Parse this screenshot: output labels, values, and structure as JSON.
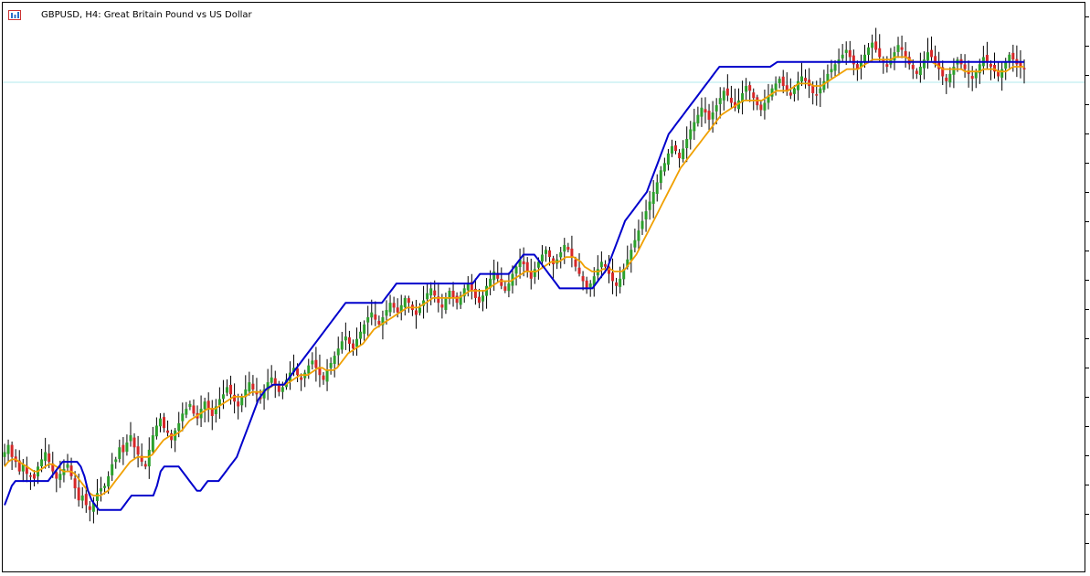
{
  "window": {
    "title": "GBPUSD, H4:  Great Britain Pound vs US Dollar",
    "symbol_text": "GBPUSD, H4:  Great Britain Pound vs US Dollar"
  },
  "icons": {
    "left": "chart-list-icon",
    "right": "chart-bars-icon"
  },
  "colors": {
    "background": "#ffffff",
    "bull": "#2ca02c",
    "bear": "#d62728",
    "wick": "#000000",
    "ma_fast": "#f0a000",
    "ma_slow": "#0000cc",
    "current_price_line": "#b0e8ee"
  },
  "chart_data": {
    "type": "line",
    "instrument": "GBPUSD",
    "timeframe": "H4",
    "grid": false,
    "candles_close": [
      88,
      91,
      86,
      84,
      80,
      83,
      79,
      78,
      77,
      82,
      85,
      88,
      84,
      80,
      77,
      79,
      81,
      83,
      78,
      73,
      68,
      70,
      66,
      64,
      67,
      71,
      73,
      74,
      78,
      83,
      85,
      90,
      88,
      92,
      95,
      90,
      87,
      84,
      82,
      89,
      95,
      99,
      102,
      98,
      96,
      93,
      97,
      100,
      104,
      106,
      108,
      104,
      102,
      106,
      109,
      106,
      103,
      107,
      110,
      112,
      115,
      112,
      109,
      107,
      111,
      114,
      117,
      114,
      112,
      110,
      114,
      117,
      119,
      116,
      113,
      115,
      118,
      121,
      123,
      120,
      118,
      121,
      124,
      126,
      123,
      120,
      118,
      122,
      125,
      128,
      131,
      134,
      136,
      133,
      131,
      135,
      138,
      141,
      144,
      146,
      143,
      141,
      144,
      147,
      150,
      148,
      146,
      149,
      152,
      150,
      147,
      145,
      148,
      151,
      154,
      156,
      153,
      150,
      148,
      152,
      155,
      152,
      150,
      153,
      156,
      158,
      155,
      152,
      150,
      153,
      157,
      160,
      163,
      160,
      157,
      155,
      158,
      162,
      165,
      168,
      166,
      163,
      160,
      164,
      167,
      170,
      172,
      169,
      166,
      168,
      171,
      174,
      172,
      169,
      165,
      162,
      159,
      156,
      158,
      161,
      164,
      167,
      165,
      162,
      159,
      157,
      160,
      164,
      168,
      172,
      176,
      180,
      184,
      188,
      192,
      196,
      200,
      205,
      208,
      212,
      215,
      213,
      210,
      214,
      218,
      222,
      225,
      228,
      231,
      229,
      226,
      229,
      232,
      235,
      238,
      236,
      233,
      231,
      234,
      237,
      240,
      238,
      235,
      232,
      230,
      233,
      236,
      239,
      241,
      243,
      240,
      238,
      236,
      239,
      242,
      244,
      242,
      240,
      237,
      236,
      239,
      242,
      245,
      247,
      249,
      251,
      253,
      255,
      252,
      249,
      247,
      250,
      253,
      256,
      258,
      255,
      252,
      250,
      248,
      251,
      254,
      257,
      255,
      252,
      249,
      247,
      245,
      248,
      251,
      254,
      252,
      249,
      247,
      244,
      242,
      245,
      248,
      251,
      249,
      247,
      245,
      243,
      246,
      249,
      252,
      250,
      248,
      246,
      244,
      247,
      250,
      253,
      251,
      249,
      248,
      247
    ],
    "ma_fast": [
      82,
      84,
      85,
      85,
      84,
      83,
      82,
      81,
      80,
      80,
      81,
      82,
      83,
      83,
      82,
      81,
      80,
      80,
      80,
      79,
      77,
      75,
      73,
      71,
      70,
      70,
      70,
      71,
      72,
      74,
      76,
      78,
      80,
      82,
      84,
      85,
      86,
      86,
      86,
      86,
      87,
      89,
      91,
      93,
      94,
      95,
      95,
      96,
      97,
      99,
      101,
      102,
      103,
      104,
      105,
      106,
      106,
      106,
      107,
      108,
      109,
      110,
      111,
      111,
      111,
      111,
      112,
      113,
      113,
      113,
      113,
      114,
      115,
      116,
      116,
      116,
      116,
      117,
      118,
      119,
      120,
      120,
      120,
      121,
      122,
      123,
      123,
      122,
      122,
      122,
      123,
      125,
      127,
      129,
      130,
      131,
      132,
      133,
      135,
      137,
      139,
      140,
      141,
      142,
      143,
      144,
      145,
      146,
      147,
      148,
      148,
      148,
      148,
      149,
      150,
      151,
      152,
      152,
      152,
      152,
      152,
      152,
      152,
      152,
      153,
      154,
      155,
      155,
      155,
      155,
      155,
      156,
      157,
      158,
      159,
      159,
      159,
      159,
      160,
      161,
      162,
      163,
      163,
      163,
      163,
      164,
      165,
      166,
      167,
      167,
      167,
      168,
      169,
      169,
      169,
      168,
      167,
      165,
      164,
      163,
      163,
      163,
      164,
      164,
      164,
      163,
      163,
      163,
      164,
      166,
      168,
      170,
      173,
      176,
      179,
      182,
      185,
      188,
      191,
      194,
      197,
      200,
      203,
      206,
      208,
      210,
      212,
      214,
      216,
      218,
      220,
      222,
      224,
      226,
      228,
      229,
      230,
      231,
      232,
      233,
      234,
      234,
      234,
      234,
      234,
      234,
      235,
      236,
      237,
      238,
      238,
      238,
      238,
      239,
      240,
      241,
      241,
      241,
      241,
      240,
      240,
      240,
      241,
      242,
      243,
      244,
      245,
      246,
      247,
      247,
      247,
      247,
      248,
      249,
      250,
      251,
      251,
      251,
      251,
      251,
      251,
      252,
      252,
      252,
      252,
      251,
      250,
      250,
      250,
      250,
      250,
      250,
      249,
      248,
      247,
      247,
      247,
      247,
      247,
      247,
      246,
      246,
      246,
      246,
      246,
      247,
      247,
      247,
      247,
      246,
      246,
      246,
      247,
      248,
      248,
      248,
      248
    ],
    "ma_slow": [
      66,
      70,
      74,
      76,
      76,
      76,
      76,
      76,
      76,
      76,
      76,
      76,
      76,
      78,
      80,
      82,
      84,
      84,
      84,
      84,
      84,
      82,
      78,
      72,
      68,
      66,
      64,
      64,
      64,
      64,
      64,
      64,
      64,
      66,
      68,
      70,
      70,
      70,
      70,
      70,
      70,
      70,
      74,
      80,
      82,
      82,
      82,
      82,
      82,
      80,
      78,
      76,
      74,
      72,
      72,
      74,
      76,
      76,
      76,
      76,
      78,
      80,
      82,
      84,
      86,
      90,
      94,
      98,
      102,
      106,
      110,
      112,
      114,
      115,
      116,
      116,
      116,
      116,
      118,
      120,
      122,
      124,
      126,
      128,
      130,
      132,
      134,
      136,
      138,
      140,
      142,
      144,
      146,
      148,
      150,
      150,
      150,
      150,
      150,
      150,
      150,
      150,
      150,
      150,
      150,
      152,
      154,
      156,
      158,
      158,
      158,
      158,
      158,
      158,
      158,
      158,
      158,
      158,
      158,
      158,
      158,
      158,
      158,
      158,
      158,
      158,
      158,
      158,
      158,
      158,
      160,
      162,
      162,
      162,
      162,
      162,
      162,
      162,
      162,
      162,
      164,
      166,
      168,
      170,
      170,
      170,
      170,
      168,
      166,
      164,
      162,
      160,
      158,
      156,
      156,
      156,
      156,
      156,
      156,
      156,
      156,
      156,
      156,
      158,
      160,
      162,
      164,
      168,
      172,
      176,
      180,
      184,
      186,
      188,
      190,
      192,
      194,
      196,
      200,
      204,
      208,
      212,
      216,
      220,
      222,
      224,
      226,
      228,
      230,
      232,
      234,
      236,
      238,
      240,
      242,
      244,
      246,
      248,
      248,
      248,
      248,
      248,
      248,
      248,
      248,
      248,
      248,
      248,
      248,
      248,
      248,
      248,
      249,
      250,
      250,
      250,
      250,
      250,
      250,
      250,
      250,
      250,
      250,
      250,
      250,
      250,
      250,
      250,
      250,
      250,
      250,
      250,
      250,
      250,
      250,
      250,
      250,
      250,
      250,
      250,
      250,
      250,
      250,
      250,
      250,
      250,
      250,
      250,
      250,
      250,
      250,
      250,
      250,
      250,
      250,
      250,
      250,
      250,
      250,
      250,
      250,
      250,
      250,
      250,
      250,
      250,
      250,
      250,
      250,
      250,
      250,
      250,
      250,
      250,
      250,
      250,
      250,
      250,
      250,
      250,
      250,
      250
    ]
  }
}
